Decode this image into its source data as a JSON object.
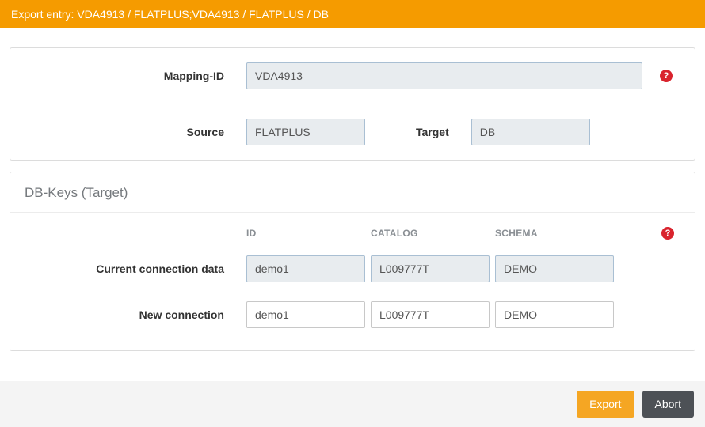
{
  "header": {
    "title": "Export entry: VDA4913 / FLATPLUS;VDA4913 / FLATPLUS / DB"
  },
  "colors": {
    "accent_orange": "#f59b00",
    "help_red": "#d9232d",
    "abort_gray": "#4d5156",
    "readonly_bg": "#e8ecef"
  },
  "mapping_panel": {
    "mapping_id_label": "Mapping-ID",
    "mapping_id_value": "VDA4913",
    "source_label": "Source",
    "source_value": "FLATPLUS",
    "target_label": "Target",
    "target_value": "DB"
  },
  "dbkeys_panel": {
    "title": "DB-Keys (Target)",
    "columns": [
      "ID",
      "CATALOG",
      "SCHEMA"
    ],
    "rows": [
      {
        "label": "Current connection data",
        "values": [
          "demo1",
          "L009777T",
          "DEMO"
        ],
        "readonly": true
      },
      {
        "label": "New connection",
        "values": [
          "demo1",
          "L009777T",
          "DEMO"
        ],
        "readonly": false
      }
    ]
  },
  "icons": {
    "help_glyph": "?"
  },
  "footer": {
    "export_label": "Export",
    "abort_label": "Abort"
  }
}
